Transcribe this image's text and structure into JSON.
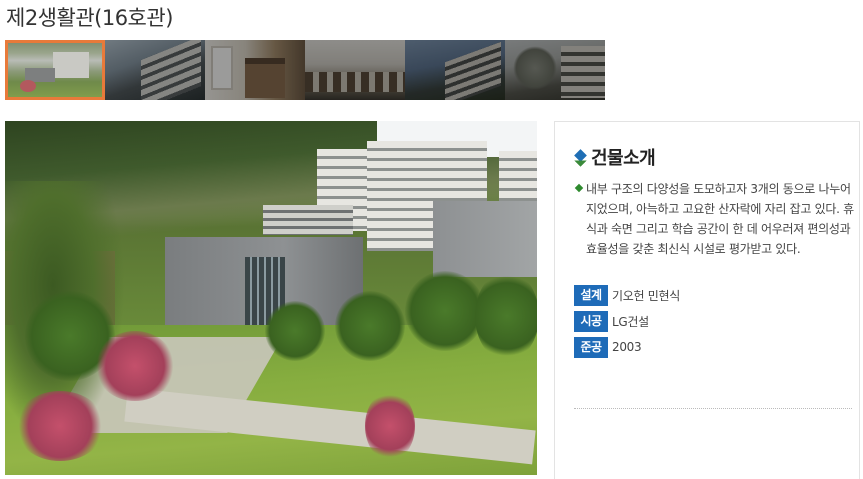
{
  "page": {
    "title": "제2생활관(16호관)"
  },
  "gallery": {
    "thumbnails": [
      {
        "icon": "photo-thumbnail",
        "active": true
      },
      {
        "icon": "photo-thumbnail",
        "active": false
      },
      {
        "icon": "photo-thumbnail",
        "active": false
      },
      {
        "icon": "photo-thumbnail",
        "active": false
      },
      {
        "icon": "photo-thumbnail",
        "active": false
      },
      {
        "icon": "photo-thumbnail",
        "active": false
      }
    ],
    "active_border_color": "#e87a3a"
  },
  "info": {
    "heading": "건물소개",
    "description": "내부 구조의 다양성을 도모하고자 3개의 동으로 나누어지었으며, 아늑하고 고요한 산자락에 자리 잡고 있다. 휴식과 숙면 그리고 학습 공간이 한 데 어우러져 편의성과 효율성을 갖춘 최신식 시설로 평가받고 있다.",
    "specs": [
      {
        "label": "설계",
        "value": "기오헌 민현식"
      },
      {
        "label": "시공",
        "value": "LG건설"
      },
      {
        "label": "준공",
        "value": "2003"
      }
    ],
    "label_color": "#1e6bb8"
  }
}
